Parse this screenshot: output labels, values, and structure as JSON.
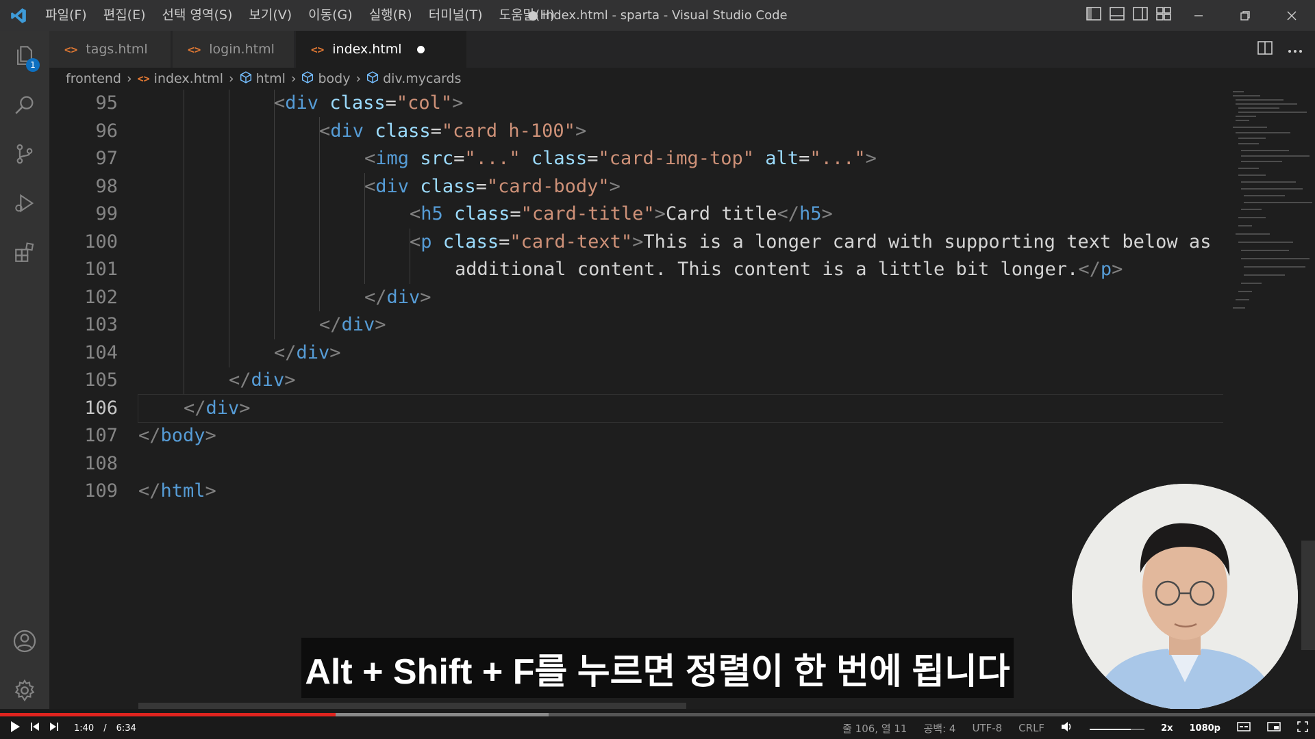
{
  "titlebar": {
    "menu": [
      "파일(F)",
      "편집(E)",
      "선택 영역(S)",
      "보기(V)",
      "이동(G)",
      "실행(R)",
      "터미널(T)",
      "도움말(H)"
    ],
    "window_title": "● index.html - sparta - Visual Studio Code"
  },
  "activity": {
    "explorer_badge": "1"
  },
  "tabs": [
    {
      "label": "tags.html"
    },
    {
      "label": "login.html"
    },
    {
      "label": "index.html"
    }
  ],
  "breadcrumb": [
    "frontend",
    "index.html",
    "html",
    "body",
    "div.mycards"
  ],
  "editor": {
    "current_line": "106",
    "line_numbers": [
      "95",
      "96",
      "97",
      "98",
      "99",
      "100",
      "101",
      "102",
      "103",
      "104",
      "105",
      "106",
      "107",
      "108",
      "109"
    ],
    "tokens": {
      "div": "div",
      "class": "class",
      "col": "\"col\"",
      "card_h100": "\"card h-100\"",
      "img": "img",
      "src": "src",
      "dots": "\"...\"",
      "card_img_top": "\"card-img-top\"",
      "alt": "alt",
      "card_body": "\"card-body\"",
      "h5": "h5",
      "card_title_cls": "\"card-title\"",
      "card_title_txt": "Card title",
      "p": "p",
      "card_text_cls": "\"card-text\"",
      "p_text_1": "This is a longer card with supporting text below as",
      "p_text_2": "additional content. This content is a little bit longer.",
      "body": "body",
      "html": "html"
    }
  },
  "caption": "Alt + Shift + F를 누르면 정렬이 한 번에 됩니다",
  "player": {
    "current_time": "1:40",
    "separator": "/",
    "duration": "6:34",
    "played_fraction": 0.255,
    "buffered_fraction": 0.417
  },
  "statusbar": {
    "position": "줄 106, 열 11",
    "indent": "공백: 4",
    "encoding": "UTF-8",
    "eol": "CRLF",
    "speed": "2x",
    "quality": "1080p"
  }
}
